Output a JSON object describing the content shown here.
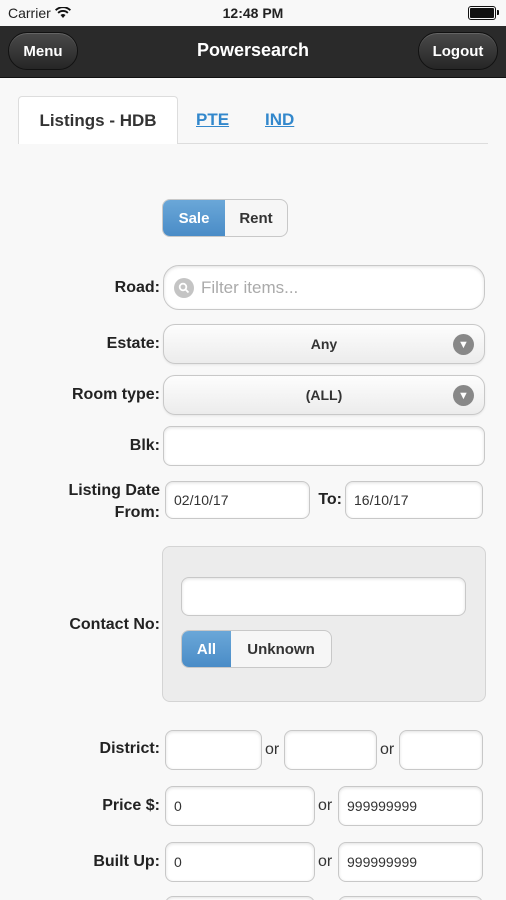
{
  "status": {
    "carrier": "Carrier",
    "time": "12:48 PM"
  },
  "navbar": {
    "menu": "Menu",
    "title": "Powersearch",
    "logout": "Logout"
  },
  "tabs": {
    "active": "Listings - HDB",
    "links": [
      "PTE",
      "IND"
    ]
  },
  "mode": {
    "options": [
      "Sale",
      "Rent"
    ],
    "selected": "Sale"
  },
  "form": {
    "road_label": "Road:",
    "road_placeholder": "Filter items...",
    "estate_label": "Estate:",
    "estate_value": "Any",
    "room_label": "Room type:",
    "room_value": "(ALL)",
    "blk_label": "Blk:",
    "date_label_line1": "Listing Date",
    "date_label_line2": "From:",
    "date_from": "02/10/17",
    "to_label": "To:",
    "date_to": "16/10/17",
    "contact_label": "Contact No:",
    "contact_filter": {
      "options": [
        "All",
        "Unknown"
      ],
      "selected": "All"
    },
    "district_label": "District:",
    "or": "or",
    "price_label": "Price $:",
    "price_min": "0",
    "price_max": "999999999",
    "builtup_label": "Built Up:",
    "builtup_min": "0",
    "builtup_max": "999999999"
  }
}
